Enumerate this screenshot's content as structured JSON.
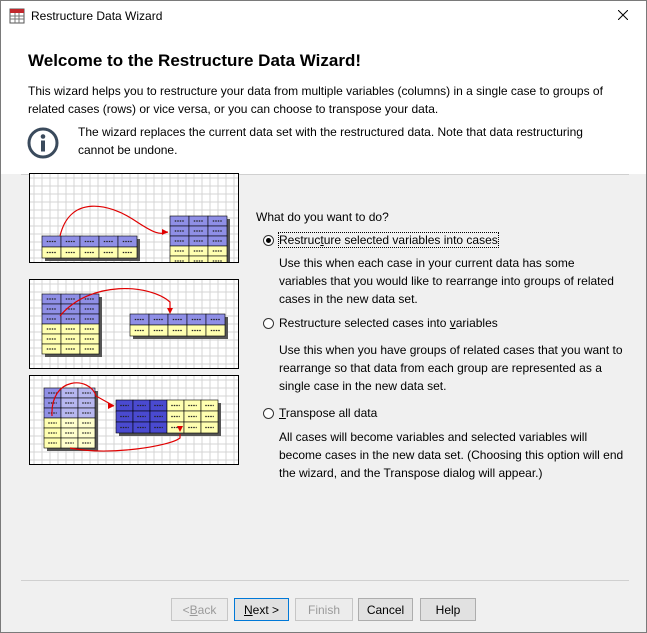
{
  "window": {
    "title": "Restructure Data Wizard"
  },
  "header": {
    "heading": "Welcome to the Restructure Data Wizard!",
    "intro": "This wizard helps you to restructure your data from multiple variables (columns) in a single case to groups of related cases (rows) or vice versa, or you can choose to transpose your data.",
    "info": "The wizard replaces the current data set with the restructured data.  Note that data restructuring cannot be undone."
  },
  "main": {
    "question": "What do you want to do?",
    "options": [
      {
        "pre": "Restruc",
        "key": "t",
        "post": "ure selected variables into cases",
        "checked": true,
        "description": "Use this when each case in your current data has some variables that you would like to rearrange into groups of related cases in the new data set."
      },
      {
        "pre": "Restructure selected cases into ",
        "key": "v",
        "post": "ariables",
        "checked": false,
        "description": "Use this when you have groups of related cases that you want to rearrange so that data from each group are represented as a single case in the new data set."
      },
      {
        "pre": "",
        "key": "T",
        "post": "ranspose all data",
        "checked": false,
        "description": "All cases will become variables and selected variables will become cases in the new data set. (Choosing this option will end the wizard, and the Transpose dialog will appear.)"
      }
    ]
  },
  "buttons": {
    "back": {
      "pre": "< ",
      "key": "B",
      "post": "ack",
      "enabled": false
    },
    "next": {
      "pre": "",
      "key": "N",
      "post": "ext >",
      "enabled": true
    },
    "finish": {
      "label": "Finish",
      "enabled": false
    },
    "cancel": {
      "label": "Cancel"
    },
    "help": {
      "label": "Help"
    }
  },
  "colors": {
    "accent": "#0078d7",
    "blue_cell": "#8f8fe6",
    "yellow_cell": "#ffffb0",
    "arrow": "#e00000"
  }
}
